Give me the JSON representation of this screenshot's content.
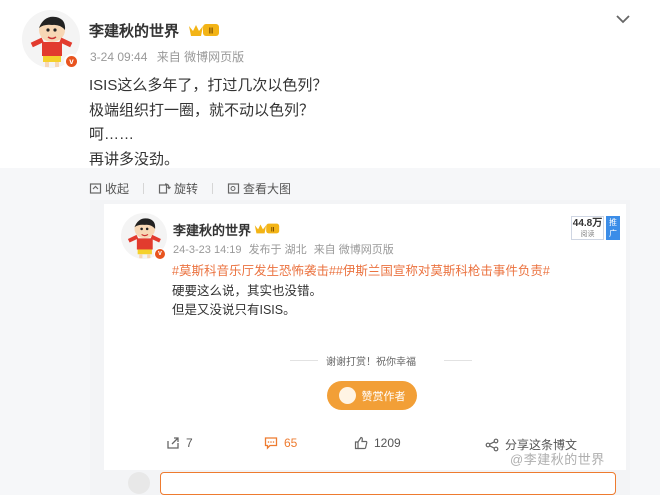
{
  "post": {
    "author": "李建秋的世界",
    "level_badge": "II",
    "time": "3-24 09:44",
    "source": "来自 微博网页版",
    "lines": [
      "ISIS这么多年了，打过几次以色列？",
      "极端组织打一圈，就不动以色列？",
      "呵……",
      "再讲多没劲。"
    ],
    "actions": {
      "favorite": "收起",
      "repost": "旋转",
      "view_image": "查看大图"
    }
  },
  "repost": {
    "author": "李建秋的世界",
    "level_badge": "II",
    "time": "24-3-23 14:19",
    "published_in": "发布于 湖北",
    "source": "来自 微博网页版",
    "views_number": "44.8万",
    "views_label": "阅读",
    "promo_label": "推广",
    "hashtags": "#莫斯科音乐厅发生恐怖袭击##伊斯兰国宣称对莫斯科枪击事件负责#",
    "lines": [
      "硬要这么说，其实也没错。",
      "但是又没说只有ISIS。"
    ],
    "thanks": "谢谢打赏！祝你幸福",
    "reward_button": "赞赏作者",
    "repost_count": "7",
    "comment_count": "65",
    "like_count": "1209",
    "share_label": "分享这条博文"
  },
  "watermark": "@李建秋的世界",
  "colors": {
    "accent": "#ee7b2f",
    "hashtag": "#eb7340",
    "text": "#333333",
    "meta": "#999999"
  }
}
